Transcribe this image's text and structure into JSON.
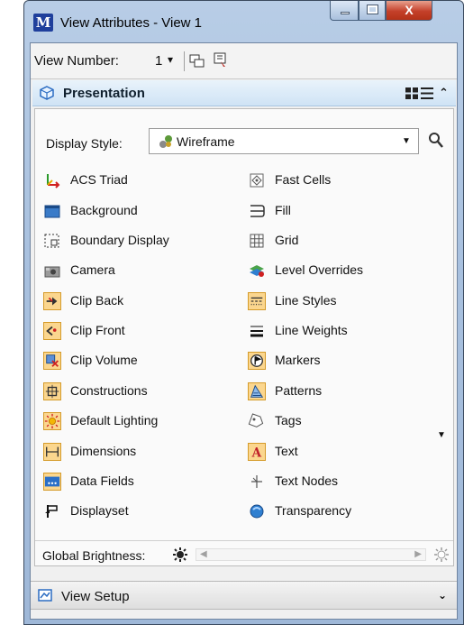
{
  "window": {
    "title": "View Attributes - View 1",
    "close_symbol": "X"
  },
  "toolbar": {
    "view_number_label": "View Number:",
    "view_number_value": "1",
    "caret": "▾"
  },
  "section": {
    "title": "Presentation",
    "collapse_symbol": "⌃"
  },
  "display_style": {
    "label": "Display Style:",
    "value": "Wireframe",
    "caret": "▼"
  },
  "attributes_left": [
    {
      "label": "ACS Triad",
      "icon": "acs-triad-icon",
      "on": false
    },
    {
      "label": "Background",
      "icon": "background-icon",
      "on": false
    },
    {
      "label": "Boundary Display",
      "icon": "boundary-display-icon",
      "on": false
    },
    {
      "label": "Camera",
      "icon": "camera-icon",
      "on": false
    },
    {
      "label": "Clip Back",
      "icon": "clip-back-icon",
      "on": true
    },
    {
      "label": "Clip Front",
      "icon": "clip-front-icon",
      "on": true
    },
    {
      "label": "Clip Volume",
      "icon": "clip-volume-icon",
      "on": true
    },
    {
      "label": "Constructions",
      "icon": "constructions-icon",
      "on": true
    },
    {
      "label": "Default Lighting",
      "icon": "default-lighting-icon",
      "on": true
    },
    {
      "label": "Dimensions",
      "icon": "dimensions-icon",
      "on": true
    },
    {
      "label": "Data Fields",
      "icon": "data-fields-icon",
      "on": true
    },
    {
      "label": "Displayset",
      "icon": "displayset-icon",
      "on": false
    }
  ],
  "attributes_right": [
    {
      "label": "Fast Cells",
      "icon": "fast-cells-icon",
      "on": false
    },
    {
      "label": "Fill",
      "icon": "fill-icon",
      "on": false
    },
    {
      "label": "Grid",
      "icon": "grid-icon",
      "on": false
    },
    {
      "label": "Level Overrides",
      "icon": "level-overrides-icon",
      "on": false
    },
    {
      "label": "Line Styles",
      "icon": "line-styles-icon",
      "on": true
    },
    {
      "label": "Line Weights",
      "icon": "line-weights-icon",
      "on": false
    },
    {
      "label": "Markers",
      "icon": "markers-icon",
      "on": true
    },
    {
      "label": "Patterns",
      "icon": "patterns-icon",
      "on": true
    },
    {
      "label": "Tags",
      "icon": "tags-icon",
      "on": false
    },
    {
      "label": "Text",
      "icon": "text-icon",
      "on": true
    },
    {
      "label": "Text Nodes",
      "icon": "text-nodes-icon",
      "on": false
    },
    {
      "label": "Transparency",
      "icon": "transparency-icon",
      "on": false
    }
  ],
  "markers_caret": "▼",
  "brightness": {
    "label": "Global Brightness:",
    "left_arrow": "◀",
    "right_arrow": "▶"
  },
  "footer": {
    "label": "View Setup",
    "expand_symbol": "⌄"
  }
}
